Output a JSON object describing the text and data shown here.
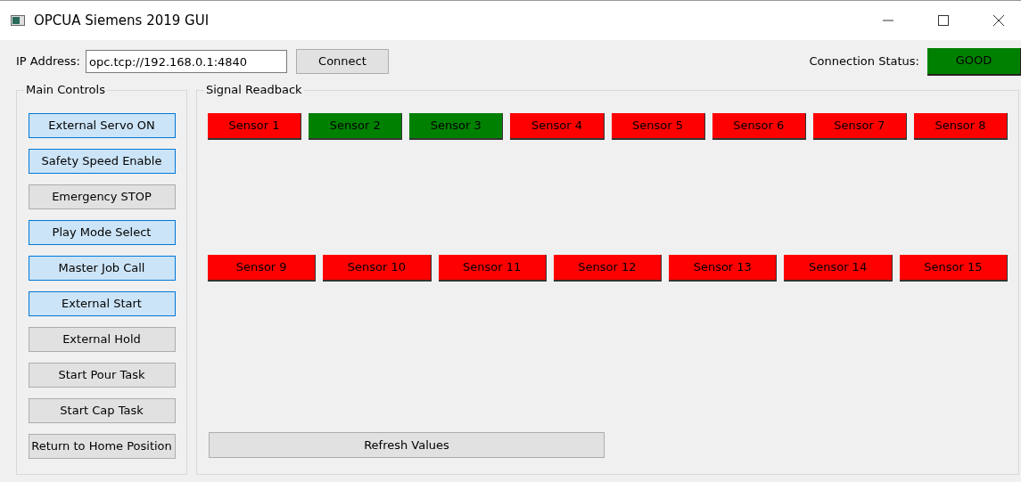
{
  "window": {
    "title": "OPCUA Siemens 2019 GUI"
  },
  "ip_address": {
    "label": "IP Address:",
    "value": "opc.tcp://192.168.0.1:4840"
  },
  "connect_button": "Connect",
  "connection_status": {
    "label": "Connection Status:",
    "value": "GOOD",
    "ok": true
  },
  "main_controls": {
    "title": "Main Controls",
    "buttons": [
      {
        "label": "External Servo ON",
        "on": true
      },
      {
        "label": "Safety Speed Enable",
        "on": true
      },
      {
        "label": "Emergency STOP",
        "on": false
      },
      {
        "label": "Play Mode Select",
        "on": true
      },
      {
        "label": "Master Job Call",
        "on": true
      },
      {
        "label": "External Start",
        "on": true
      },
      {
        "label": "External Hold",
        "on": false
      },
      {
        "label": "Start Pour Task",
        "on": false
      },
      {
        "label": "Start Cap Task",
        "on": false
      },
      {
        "label": "Return to Home Position",
        "on": false
      }
    ]
  },
  "signal_readback": {
    "title": "Signal Readback",
    "sensor_rows": [
      [
        {
          "label": "Sensor 1",
          "on": false
        },
        {
          "label": "Sensor 2",
          "on": true
        },
        {
          "label": "Sensor 3",
          "on": true
        },
        {
          "label": "Sensor 4",
          "on": false
        },
        {
          "label": "Sensor 5",
          "on": false
        },
        {
          "label": "Sensor 6",
          "on": false
        },
        {
          "label": "Sensor 7",
          "on": false
        },
        {
          "label": "Sensor 8",
          "on": false
        }
      ],
      [
        {
          "label": "Sensor 9",
          "on": false
        },
        {
          "label": "Sensor 10",
          "on": false
        },
        {
          "label": "Sensor 11",
          "on": false
        },
        {
          "label": "Sensor 12",
          "on": false
        },
        {
          "label": "Sensor 13",
          "on": false
        },
        {
          "label": "Sensor 14",
          "on": false
        },
        {
          "label": "Sensor 15",
          "on": false
        }
      ]
    ],
    "refresh_button": "Refresh Values"
  }
}
